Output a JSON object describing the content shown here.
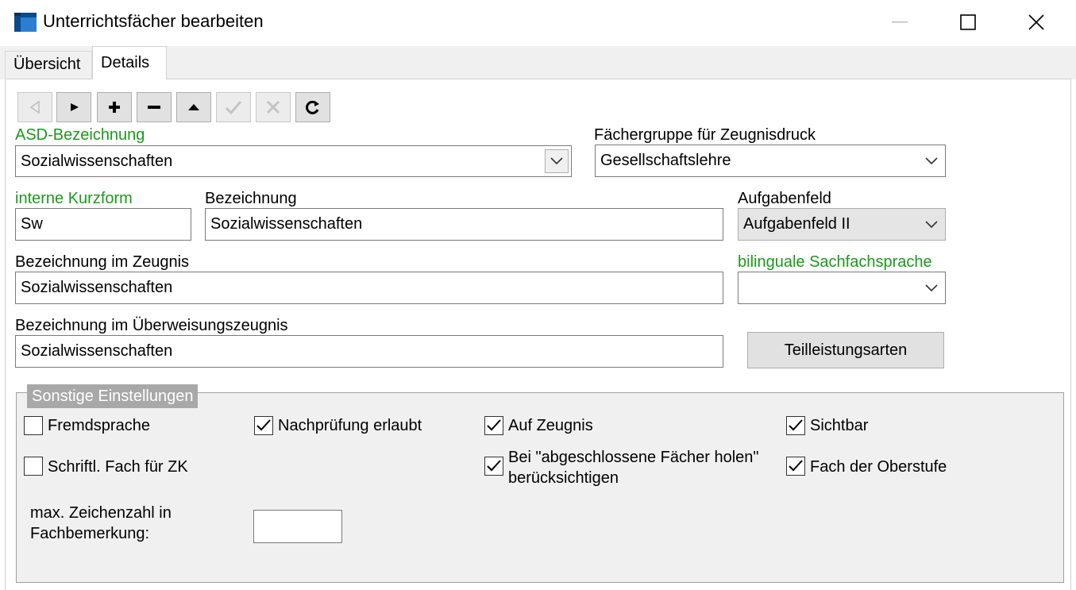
{
  "window": {
    "title": "Unterrichtsfächer bearbeiten"
  },
  "tabs": [
    {
      "label": "Übersicht",
      "active": false
    },
    {
      "label": "Details",
      "active": true
    }
  ],
  "toolbar": {
    "buttons": [
      {
        "icon": "first-record-icon",
        "enabled": false
      },
      {
        "icon": "next-record-icon",
        "enabled": true
      },
      {
        "icon": "add-icon",
        "enabled": true
      },
      {
        "icon": "remove-icon",
        "enabled": true
      },
      {
        "icon": "move-up-icon",
        "enabled": true
      },
      {
        "icon": "confirm-icon",
        "enabled": false
      },
      {
        "icon": "cancel-icon",
        "enabled": false
      },
      {
        "icon": "refresh-icon",
        "enabled": true
      }
    ]
  },
  "form": {
    "asd_label": "ASD-Bezeichnung",
    "asd_value": "Sozialwissenschaften",
    "faechergruppe_label": "Fächergruppe für Zeugnisdruck",
    "faechergruppe_value": "Gesellschaftslehre",
    "kurzform_label": "interne Kurzform",
    "kurzform_value": "Sw",
    "bezeichnung_label": "Bezeichnung",
    "bezeichnung_value": "Sozialwissenschaften",
    "aufgabenfeld_label": "Aufgabenfeld",
    "aufgabenfeld_value": "Aufgabenfeld II",
    "zeugnis_label": "Bezeichnung im Zeugnis",
    "zeugnis_value": "Sozialwissenschaften",
    "bilingual_label": "bilinguale Sachfachsprache",
    "bilingual_value": "",
    "ueberweisung_label": "Bezeichnung im Überweisungszeugnis",
    "ueberweisung_value": "Sozialwissenschaften",
    "teilleistung_button": "Teilleistungsarten"
  },
  "sonstige": {
    "title": "Sonstige Einstellungen",
    "checkboxes": {
      "fremdsprache": {
        "label": "Fremdsprache",
        "checked": false
      },
      "nachpruefung": {
        "label": "Nachprüfung erlaubt",
        "checked": true
      },
      "auf_zeugnis": {
        "label": "Auf Zeugnis",
        "checked": true
      },
      "sichtbar": {
        "label": "Sichtbar",
        "checked": true
      },
      "schriftl": {
        "label": "Schriftl. Fach für ZK",
        "checked": false
      },
      "abgeschlossen_line1": "Bei \"abgeschlossene Fächer holen\"",
      "abgeschlossen_line2": "berücksichtigen",
      "abgeschlossen_checked": true,
      "oberstufe": {
        "label": "Fach der Oberstufe",
        "checked": true
      }
    },
    "max_zeichen_line1": "max. Zeichenzahl in",
    "max_zeichen_line2": "Fachbemerkung:",
    "max_zeichen_value": ""
  }
}
